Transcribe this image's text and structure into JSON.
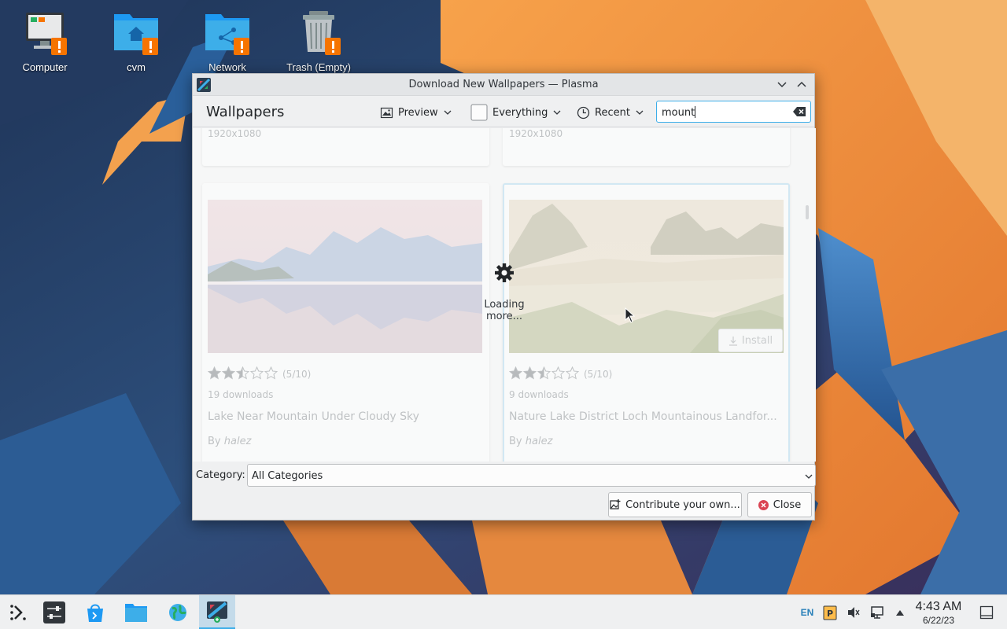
{
  "desktop": {
    "icons": [
      {
        "label": "Computer",
        "icon": "computer-icon"
      },
      {
        "label": "cvm",
        "icon": "home-folder-icon"
      },
      {
        "label": "Network",
        "icon": "network-folder-icon"
      },
      {
        "label": "Trash (Empty)",
        "icon": "trash-icon"
      }
    ]
  },
  "dialog": {
    "title": "Download New Wallpapers — Plasma",
    "heading": "Wallpapers",
    "toolbar": {
      "view_label": "Preview",
      "filter_label": "Everything",
      "sort_label": "Recent",
      "search_value": "mount"
    },
    "cards": [
      {
        "resolution": "1920x1080",
        "rating_text": "(5/10)",
        "rating": 5,
        "downloads": "19 downloads",
        "title": "Lake Near Mountain Under Cloudy Sky",
        "author_prefix": "By",
        "author": "halez"
      },
      {
        "resolution": "1920x1080",
        "rating_text": "(5/10)",
        "rating": 5,
        "downloads": "9 downloads",
        "title": "Nature Lake District Loch Mountainous Landfor...",
        "author_prefix": "By",
        "author": "halez",
        "install_label": "Install"
      }
    ],
    "loading_text": "Loading more...",
    "category_label": "Category:",
    "category_value": "All Categories",
    "contribute_label": "Contribute your own...",
    "close_label": "Close"
  },
  "taskbar": {
    "language": "EN",
    "time": "4:43 AM",
    "date": "6/22/23"
  },
  "colors": {
    "accent": "#3daee9",
    "window_bg": "#eff0f1",
    "close_red": "#da4453",
    "badge_orange": "#f67400"
  }
}
